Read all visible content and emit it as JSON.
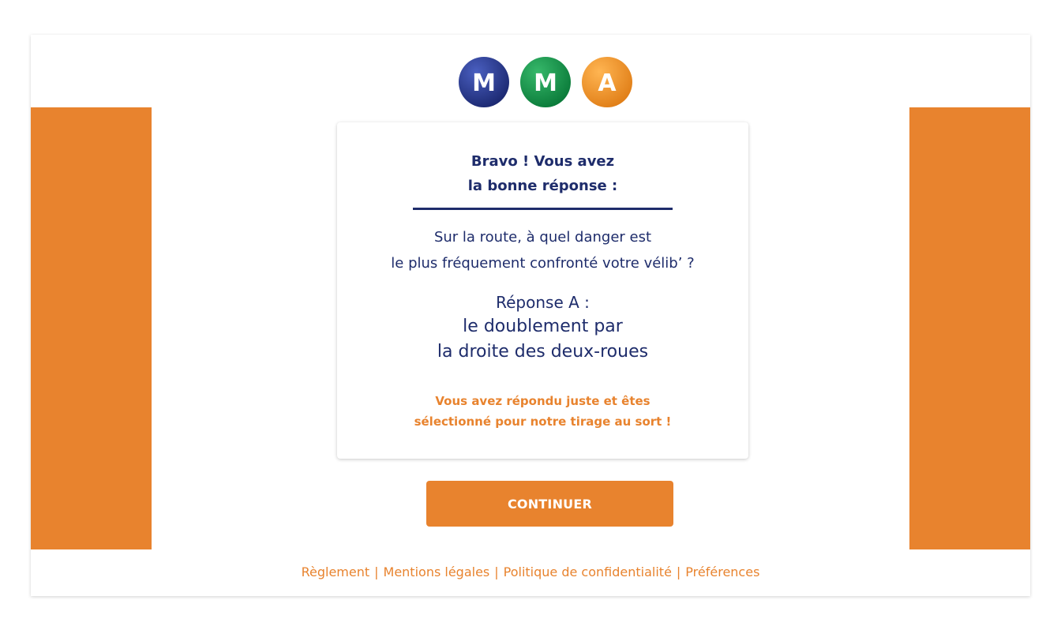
{
  "colors": {
    "orange": "#E8832E",
    "navy": "#1E2C6B",
    "logo_blue": "#25368A",
    "logo_green": "#0F9547",
    "logo_orange": "#F0962A"
  },
  "logo": {
    "letters": [
      "M",
      "M",
      "A"
    ]
  },
  "card": {
    "title_line1": "Bravo ! Vous avez",
    "title_line2": "la bonne réponse :",
    "question_line1": "Sur la route, à quel danger est",
    "question_line2": "le plus fréquement confronté votre vélib’ ?",
    "answer_label": "Réponse A :",
    "answer_line1": "le doublement par",
    "answer_line2": "la droite des deux-roues",
    "selected_line1": "Vous avez répondu juste et êtes",
    "selected_line2": "sélectionné pour notre tirage au sort !"
  },
  "continue_label": "CONTINUER",
  "footer": {
    "links": [
      "Règlement",
      "Mentions légales",
      "Politique de confidentialité",
      "Préférences"
    ],
    "separator": "|"
  }
}
